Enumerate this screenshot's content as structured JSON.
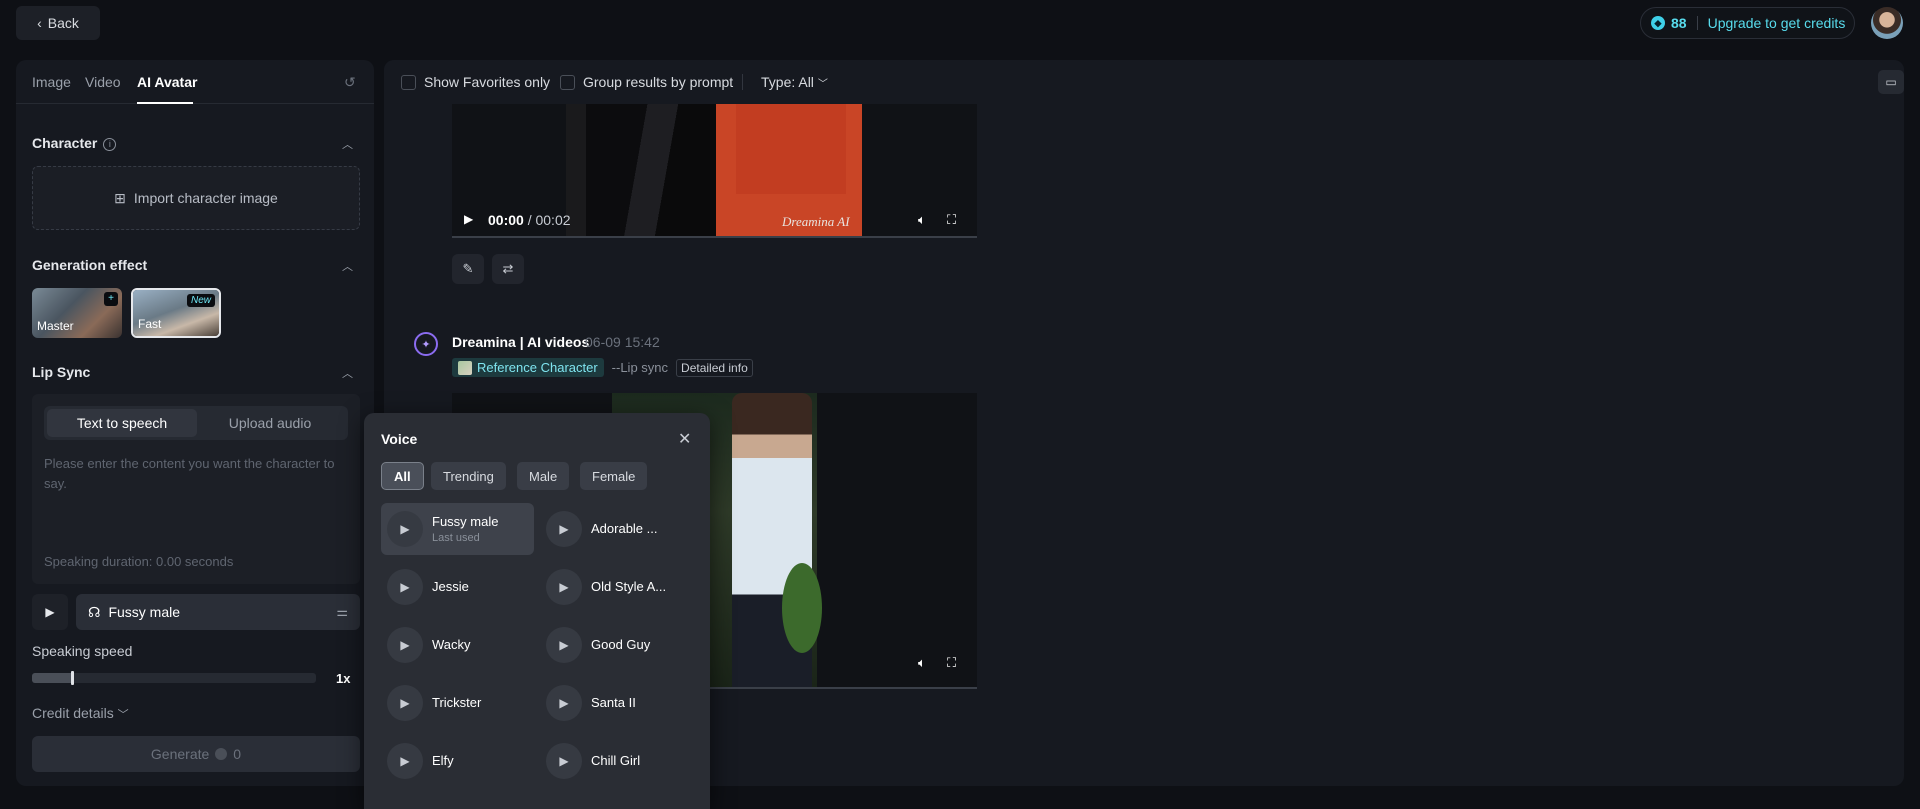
{
  "topbar": {
    "back_label": "Back",
    "credit_count": "88",
    "upgrade_label": "Upgrade to get credits"
  },
  "left": {
    "tabs": [
      "Image",
      "Video",
      "AI Avatar"
    ],
    "active_tab": "AI Avatar",
    "character": {
      "title": "Character",
      "import_label": "Import character image"
    },
    "generation_effect": {
      "title": "Generation effect",
      "options": [
        {
          "label": "Master",
          "badge": "+"
        },
        {
          "label": "Fast",
          "badge": "New"
        }
      ]
    },
    "lip_sync": {
      "title": "Lip Sync",
      "modes": [
        "Text to speech",
        "Upload audio"
      ],
      "active_mode": "Text to speech",
      "placeholder": "Please enter the content you want the character to say.",
      "duration": "Speaking duration: 0.00 seconds"
    },
    "voice_select": {
      "value": "Fussy male"
    },
    "speaking_speed": {
      "label": "Speaking speed",
      "value_label": "1x",
      "fraction": 0.14
    },
    "credit_details": "Credit details",
    "generate": {
      "label": "Generate",
      "cost": "0"
    }
  },
  "main": {
    "filters": {
      "favorites": "Show Favorites only",
      "group": "Group results by prompt",
      "type": "Type: All"
    },
    "video1": {
      "time_current": "00:00",
      "time_total": "/ 00:02",
      "watermark": "Dreamina AI"
    },
    "post": {
      "author": "Dreamina | AI videos",
      "date": "06-09  15:42",
      "ref_character": "Reference Character",
      "lip_tag": "--Lip sync",
      "detail": "Detailed info"
    }
  },
  "voice_popup": {
    "title": "Voice",
    "filters": [
      "All",
      "Trending",
      "Male",
      "Female"
    ],
    "active_filter": "All",
    "voices": [
      {
        "name": "Fussy male",
        "sub": "Last used",
        "selected": true
      },
      {
        "name": "Adorable ...",
        "sub": ""
      },
      {
        "name": "Jessie",
        "sub": ""
      },
      {
        "name": "Old Style A...",
        "sub": ""
      },
      {
        "name": "Wacky",
        "sub": ""
      },
      {
        "name": "Good Guy",
        "sub": ""
      },
      {
        "name": "Trickster",
        "sub": ""
      },
      {
        "name": "Santa II",
        "sub": ""
      },
      {
        "name": "Elfy",
        "sub": ""
      },
      {
        "name": "Chill Girl",
        "sub": ""
      }
    ]
  },
  "icons": {
    "back": "chevron-left-icon",
    "coin": "coin-icon",
    "reset": "reset-icon",
    "info": "info-icon",
    "import": "image-plus-icon",
    "collapse": "chevron-up-icon",
    "play": "play-icon",
    "voice": "voice-icon",
    "tune": "sliders-icon",
    "folder": "folder-icon",
    "volume": "volume-icon",
    "fullscreen": "fullscreen-icon",
    "edit": "pencil-icon",
    "reuse": "repeat-icon",
    "close": "close-icon"
  },
  "colors": {
    "accent": "#58dced",
    "background": "#0e1015",
    "panel": "#161920",
    "popup": "#2a2d34"
  }
}
